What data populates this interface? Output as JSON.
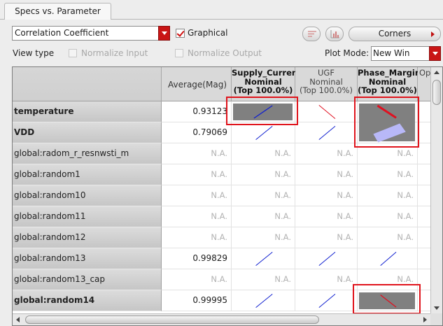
{
  "tab": {
    "label": "Specs vs. Parameter"
  },
  "toolbar": {
    "metric_value": "Correlation Coefficient",
    "graphical_label": "Graphical",
    "corners_label": "Corners"
  },
  "options": {
    "view_type_label": "View type",
    "normalize_input_label": "Normalize Input",
    "normalize_output_label": "Normalize Output",
    "plot_mode_label": "Plot Mode:",
    "plot_mode_value": "New Win"
  },
  "table": {
    "avg_header": "Average(Mag)",
    "columns": [
      {
        "name": "Supply_Current",
        "line2": "Nominal",
        "line3": "(Top 100.0%)"
      },
      {
        "name": "UGF",
        "line2": "Nominal",
        "line3": "(Top 100.0%)"
      },
      {
        "name": "Phase_Margin",
        "line2": "Nominal",
        "line3": "(Top 100.0%)"
      },
      {
        "name": "Op",
        "line2": "",
        "line3": ""
      }
    ],
    "rows": [
      {
        "label": "temperature",
        "avg": "0.93123",
        "cells": [
          "",
          "",
          "",
          ""
        ]
      },
      {
        "label": "VDD",
        "avg": "0.79069",
        "cells": [
          "",
          "",
          "",
          ""
        ]
      },
      {
        "label": "global:radom_r_resnwsti_m",
        "avg": "N.A.",
        "cells": [
          "N.A.",
          "N.A.",
          "N.A.",
          ""
        ]
      },
      {
        "label": "global:random1",
        "avg": "N.A.",
        "cells": [
          "N.A.",
          "N.A.",
          "N.A.",
          ""
        ]
      },
      {
        "label": "global:random10",
        "avg": "N.A.",
        "cells": [
          "N.A.",
          "N.A.",
          "N.A.",
          ""
        ]
      },
      {
        "label": "global:random11",
        "avg": "N.A.",
        "cells": [
          "N.A.",
          "N.A.",
          "N.A.",
          ""
        ]
      },
      {
        "label": "global:random12",
        "avg": "N.A.",
        "cells": [
          "N.A.",
          "N.A.",
          "N.A.",
          ""
        ]
      },
      {
        "label": "global:random13",
        "avg": "0.99829",
        "cells": [
          "",
          "",
          "",
          ""
        ]
      },
      {
        "label": "global:random13_cap",
        "avg": "N.A.",
        "cells": [
          "N.A.",
          "N.A.",
          "N.A.",
          ""
        ]
      },
      {
        "label": "global:random14",
        "avg": "0.99995",
        "cells": [
          "",
          "",
          "",
          ""
        ]
      }
    ]
  },
  "colors": {
    "accent_red": "#c91515",
    "highlight_box": "#e0141c",
    "plot_bg": "#808080",
    "positive_line": "#1020d0",
    "negative_line": "#e01020",
    "band_fill": "#b8b8f8"
  }
}
